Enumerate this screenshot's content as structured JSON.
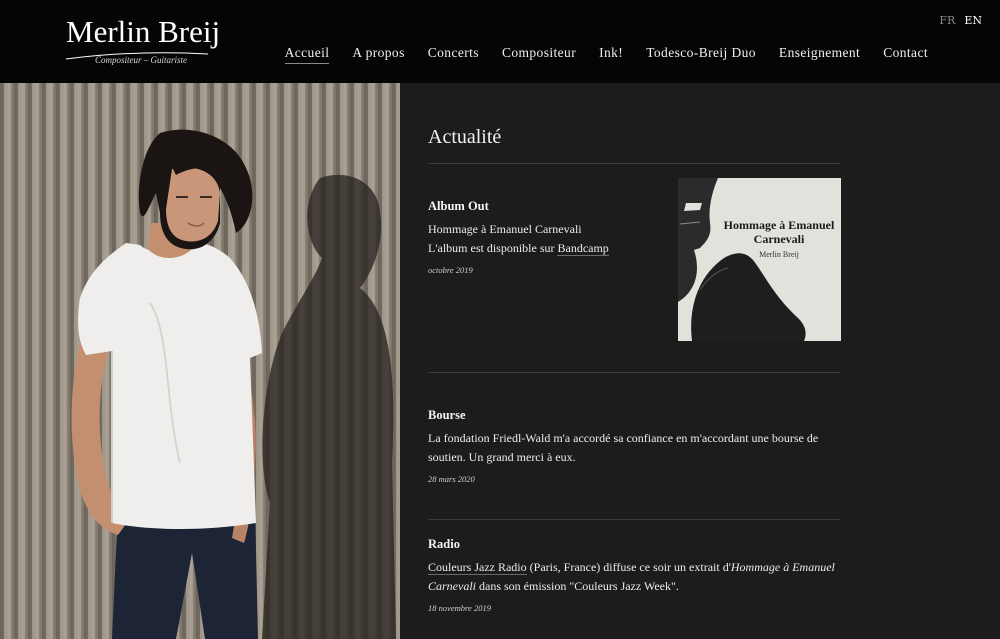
{
  "brand": {
    "name": "Merlin Breij",
    "tagline": "Compositeur – Guitariste"
  },
  "languages": [
    {
      "label": "FR",
      "active": false
    },
    {
      "label": "EN",
      "active": true
    }
  ],
  "nav": {
    "items": [
      "Accueil",
      "A propos",
      "Concerts",
      "Compositeur",
      "Ink!",
      "Todesco-Breij Duo",
      "Enseignement",
      "Contact"
    ],
    "active": "Accueil"
  },
  "main": {
    "title": "Actualité",
    "news": [
      {
        "title": "Album Out",
        "line1": "Hommage à Emanuel Carnevali",
        "line2_prefix": "L'album est disponible sur ",
        "line2_link": "Bandcamp",
        "date": "octobre 2019"
      },
      {
        "title": "Bourse",
        "body": "La fondation Friedl-Wald m'a accordé sa confiance en m'accordant une bourse de soutien. Un grand merci à eux.",
        "date": "28 mars 2020"
      },
      {
        "title": "Radio",
        "link": "Couleurs Jazz Radio",
        "text1": " (Paris, France)  diffuse ce soir un extrait d'",
        "italic": "Hommage à Emanuel Carnevali",
        "text2": " dans son émission \"Couleurs Jazz Week\".",
        "date": "18 novembre 2019"
      }
    ],
    "album_cover": {
      "title": "Hommage à Emanuel Carnevali",
      "artist": "Merlin Breij"
    }
  },
  "colors": {
    "header_bg": "#050505",
    "page_bg": "#1c1c1c",
    "text": "#ececec"
  }
}
